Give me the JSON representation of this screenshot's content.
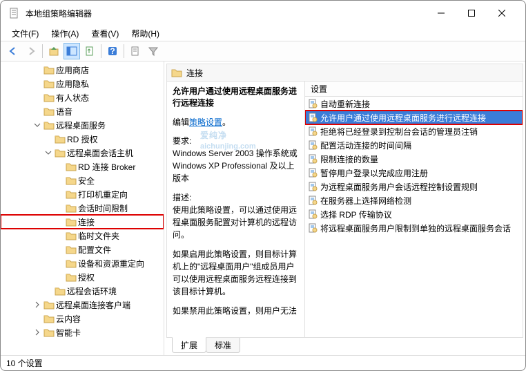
{
  "window": {
    "title": "本地组策略编辑器"
  },
  "menu": {
    "file": "文件(F)",
    "action": "操作(A)",
    "view": "查看(V)",
    "help": "帮助(H)"
  },
  "tree": [
    {
      "depth": 3,
      "tw": "",
      "label": "应用商店"
    },
    {
      "depth": 3,
      "tw": "",
      "label": "应用隐私"
    },
    {
      "depth": 3,
      "tw": "",
      "label": "有人状态"
    },
    {
      "depth": 3,
      "tw": "",
      "label": "语音"
    },
    {
      "depth": 3,
      "tw": "v",
      "label": "远程桌面服务"
    },
    {
      "depth": 4,
      "tw": "",
      "label": "RD 授权"
    },
    {
      "depth": 4,
      "tw": "v",
      "label": "远程桌面会话主机"
    },
    {
      "depth": 5,
      "tw": "",
      "label": "RD 连接 Broker"
    },
    {
      "depth": 5,
      "tw": "",
      "label": "安全"
    },
    {
      "depth": 5,
      "tw": "",
      "label": "打印机重定向"
    },
    {
      "depth": 5,
      "tw": "",
      "label": "会话时间限制"
    },
    {
      "depth": 5,
      "tw": "",
      "label": "连接",
      "hl": true
    },
    {
      "depth": 5,
      "tw": "",
      "label": "临时文件夹"
    },
    {
      "depth": 5,
      "tw": "",
      "label": "配置文件"
    },
    {
      "depth": 5,
      "tw": "",
      "label": "设备和资源重定向"
    },
    {
      "depth": 5,
      "tw": "",
      "label": "授权"
    },
    {
      "depth": 4,
      "tw": "",
      "label": "远程会话环境"
    },
    {
      "depth": 3,
      "tw": ">",
      "label": "远程桌面连接客户端"
    },
    {
      "depth": 3,
      "tw": "",
      "label": "云内容"
    },
    {
      "depth": 3,
      "tw": ">",
      "label": "智能卡"
    }
  ],
  "path": {
    "label": "连接"
  },
  "desc": {
    "heading": "允许用户通过使用远程桌面服务进行远程连接",
    "editPrefix": "编辑",
    "editLink": "策略设置",
    "reqLabel": "要求:",
    "reqBody": "Windows Server 2003 操作系统或 Windows XP Professional 及以上版本",
    "descLabel": "描述:",
    "p1": "使用此策略设置，可以通过使用远程桌面服务配置对计算机的远程访问。",
    "p2": "如果启用此策略设置，则目标计算机上的\"远程桌面用户\"组成员用户可以使用远程桌面服务远程连接到该目标计算机。",
    "p3": "如果禁用此策略设置，则用户无法"
  },
  "listHeader": "设置",
  "settings": [
    {
      "label": "自动重新连接"
    },
    {
      "label": "允许用户通过使用远程桌面服务进行远程连接",
      "sel": true
    },
    {
      "label": "拒绝将已经登录到控制台会话的管理员注销"
    },
    {
      "label": "配置活动连接的时间间隔"
    },
    {
      "label": "限制连接的数量"
    },
    {
      "label": "暂停用户登录以完成应用注册"
    },
    {
      "label": "为远程桌面服务用户会话远程控制设置规则"
    },
    {
      "label": "在服务器上选择网络检测"
    },
    {
      "label": "选择 RDP 传输协议"
    },
    {
      "label": "将远程桌面服务用户限制到单独的远程桌面服务会话"
    }
  ],
  "tabs": {
    "ext": "扩展",
    "std": "标准"
  },
  "status": "10 个设置",
  "watermark": {
    "main": "爱纯净",
    "sub": "aichunjing.com"
  }
}
